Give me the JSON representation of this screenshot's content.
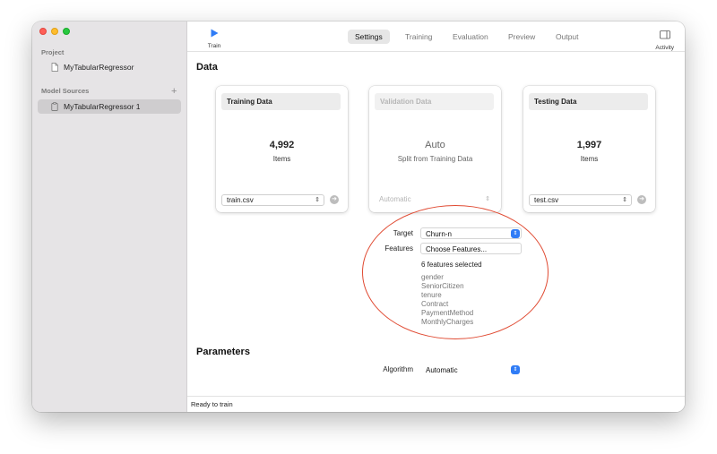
{
  "sidebar": {
    "project_header": "Project",
    "project_name": "MyTabularRegressor",
    "sources_header": "Model Sources",
    "add_symbol": "+",
    "source_item": "MyTabularRegressor 1"
  },
  "toolbar": {
    "train_label": "Train",
    "tabs": [
      "Settings",
      "Training",
      "Evaluation",
      "Preview",
      "Output"
    ],
    "active_tab": "Settings",
    "activity_label": "Activity"
  },
  "data_section": {
    "title": "Data",
    "cards": [
      {
        "title": "Training Data",
        "count": "4,992",
        "unit": "Items",
        "file": "train.csv",
        "enabled": true
      },
      {
        "title": "Validation Data",
        "count": "Auto",
        "unit": "Split from Training Data",
        "file": "Automatic",
        "enabled": false
      },
      {
        "title": "Testing Data",
        "count": "1,997",
        "unit": "Items",
        "file": "test.csv",
        "enabled": true
      }
    ]
  },
  "target": {
    "label": "Target",
    "value": "Churn-n"
  },
  "features": {
    "label": "Features",
    "button_label": "Choose Features...",
    "selected_count": "6 features selected",
    "items": [
      "gender",
      "SeniorCitizen",
      "tenure",
      "Contract",
      "PaymentMethod",
      "MonthlyCharges"
    ]
  },
  "parameters": {
    "title": "Parameters",
    "algorithm_label": "Algorithm",
    "algorithm_value": "Automatic"
  },
  "status": "Ready to train",
  "icons": {
    "play": "play-icon",
    "activity": "activity-icon",
    "document": "document-icon",
    "select_arrows": "chevron-updown-icon",
    "go": "arrow-right-circle-icon"
  },
  "colors": {
    "accent": "#2f7cf6",
    "annotation": "#e04a32"
  }
}
